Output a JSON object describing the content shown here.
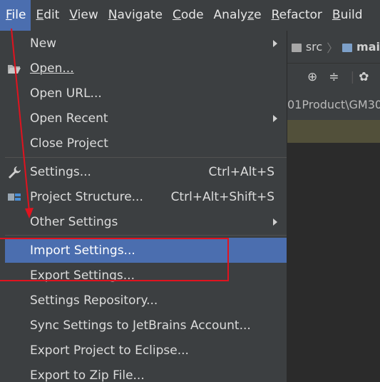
{
  "menubar": {
    "items": [
      {
        "label": "File",
        "mnemonic": "F",
        "rest": "ile"
      },
      {
        "label": "Edit",
        "mnemonic": "E",
        "rest": "dit"
      },
      {
        "label": "View",
        "mnemonic": "V",
        "rest": "iew"
      },
      {
        "label": "Navigate",
        "mnemonic": "N",
        "rest": "avigate"
      },
      {
        "label": "Code",
        "mnemonic": "C",
        "rest": "ode"
      },
      {
        "label": "Analyze",
        "pre": "Analy",
        "mnemonic": "z",
        "rest": "e"
      },
      {
        "label": "Refactor",
        "mnemonic": "R",
        "rest": "efactor"
      },
      {
        "label": "Build",
        "mnemonic": "B",
        "rest": "uild"
      }
    ]
  },
  "ide": {
    "breadcrumb": [
      "src",
      "mai"
    ],
    "path_text": "01Product\\GM30"
  },
  "file_menu": {
    "items": [
      {
        "label": "New"
      },
      {
        "label": "Open..."
      },
      {
        "label": "Open URL..."
      },
      {
        "label": "Open Recent"
      },
      {
        "label": "Close Project"
      },
      {
        "label": "Settings...",
        "shortcut": "Ctrl+Alt+S"
      },
      {
        "label": "Project Structure...",
        "shortcut": "Ctrl+Alt+Shift+S"
      },
      {
        "label": "Other Settings"
      },
      {
        "label": "Import Settings..."
      },
      {
        "label": "Export Settings..."
      },
      {
        "label": "Settings Repository..."
      },
      {
        "label": "Sync Settings to JetBrains Account..."
      },
      {
        "label": "Export Project to Eclipse..."
      },
      {
        "label": "Export to Zip File..."
      }
    ]
  },
  "colors": {
    "menu_bg": "#3c3f41",
    "selection": "#4b6eaf",
    "annotation": "#e0131f",
    "editor_bg": "#2b2b2b"
  },
  "icons": [
    "folder-open-icon",
    "wrench-icon",
    "project-structure-icon",
    "submenu-arrow-icon",
    "crosshair-icon",
    "collapse-icon",
    "gear-icon",
    "folder-icon"
  ]
}
